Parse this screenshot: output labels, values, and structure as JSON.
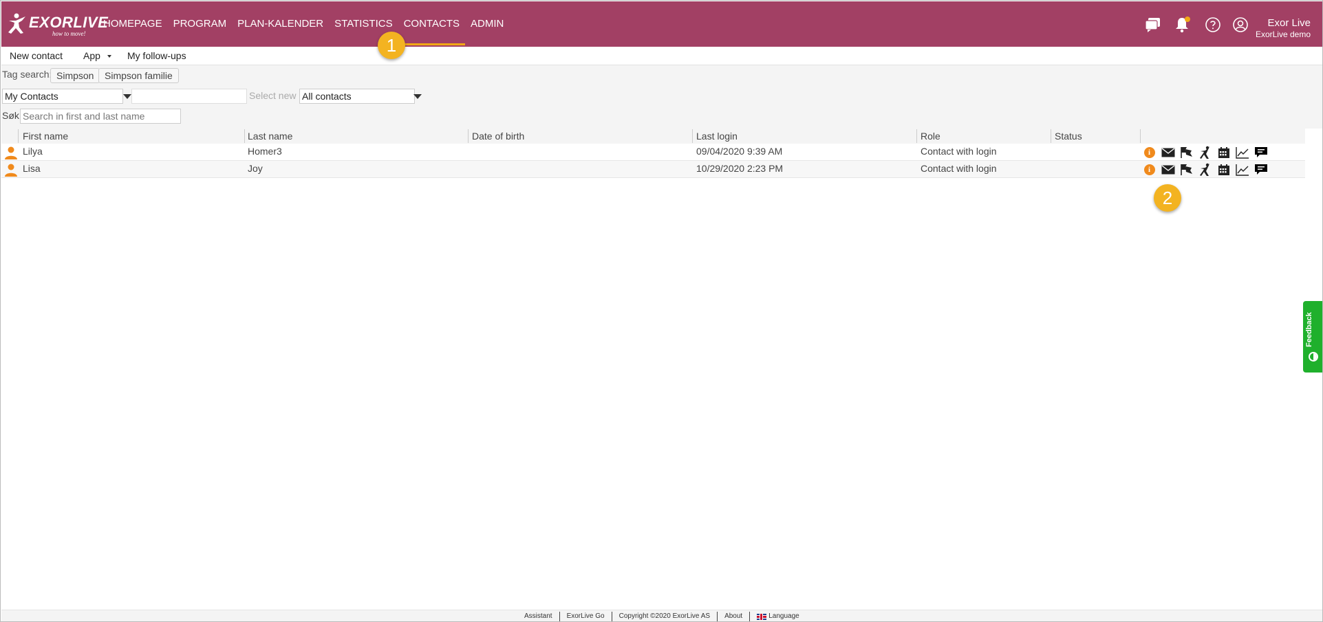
{
  "app": {
    "logo_text": "EXORLIVE",
    "logo_tagline": "how to move!"
  },
  "nav": {
    "items": [
      {
        "label": "HOMEPAGE"
      },
      {
        "label": "PROGRAM"
      },
      {
        "label": "PLAN-KALENDER"
      },
      {
        "label": "STATISTICS"
      },
      {
        "label": "CONTACTS"
      },
      {
        "label": "ADMIN"
      }
    ],
    "active": "CONTACTS"
  },
  "user": {
    "name": "Exor Live",
    "org": "ExorLive demo",
    "notification_badge_color": "#f2a916"
  },
  "subnav": {
    "new_contact": "New contact",
    "app": "App",
    "follow_ups": "My follow-ups"
  },
  "filters": {
    "tag_search_label": "Tag search:",
    "tags": [
      "Simpson",
      "Simpson familie"
    ],
    "contacts_select": "My Contacts",
    "select_new_label": "Select new",
    "all_contacts_select": "All contacts",
    "search_label": "Søk:",
    "search_placeholder": "Search in first and last name"
  },
  "table": {
    "columns": [
      "First name",
      "Last name",
      "Date of birth",
      "Last login",
      "Role",
      "Status"
    ],
    "rows": [
      {
        "first": "Lilya",
        "last": "Homer3",
        "dob": "",
        "last_login": "09/04/2020 9:39 AM",
        "role": "Contact with login",
        "status": ""
      },
      {
        "first": "Lisa",
        "last": "Joy",
        "dob": "",
        "last_login": "10/29/2020 2:23 PM",
        "role": "Contact with login",
        "status": ""
      }
    ],
    "row_actions": [
      "info-icon",
      "mail-icon",
      "flags-icon",
      "exercise-icon",
      "calendar-icon",
      "chart-icon",
      "chat-icon"
    ]
  },
  "callouts": {
    "one": "1",
    "two": "2"
  },
  "feedback": {
    "label": "Feedback"
  },
  "footer": {
    "items": [
      "Assistant",
      "ExorLive Go",
      "Copyright ©2020 ExorLive AS",
      "About",
      "Language"
    ]
  },
  "colors": {
    "brand": "#a24064",
    "accent": "#f2a916",
    "person_icon": "#f08a1c",
    "feedback": "#1fb02c"
  }
}
